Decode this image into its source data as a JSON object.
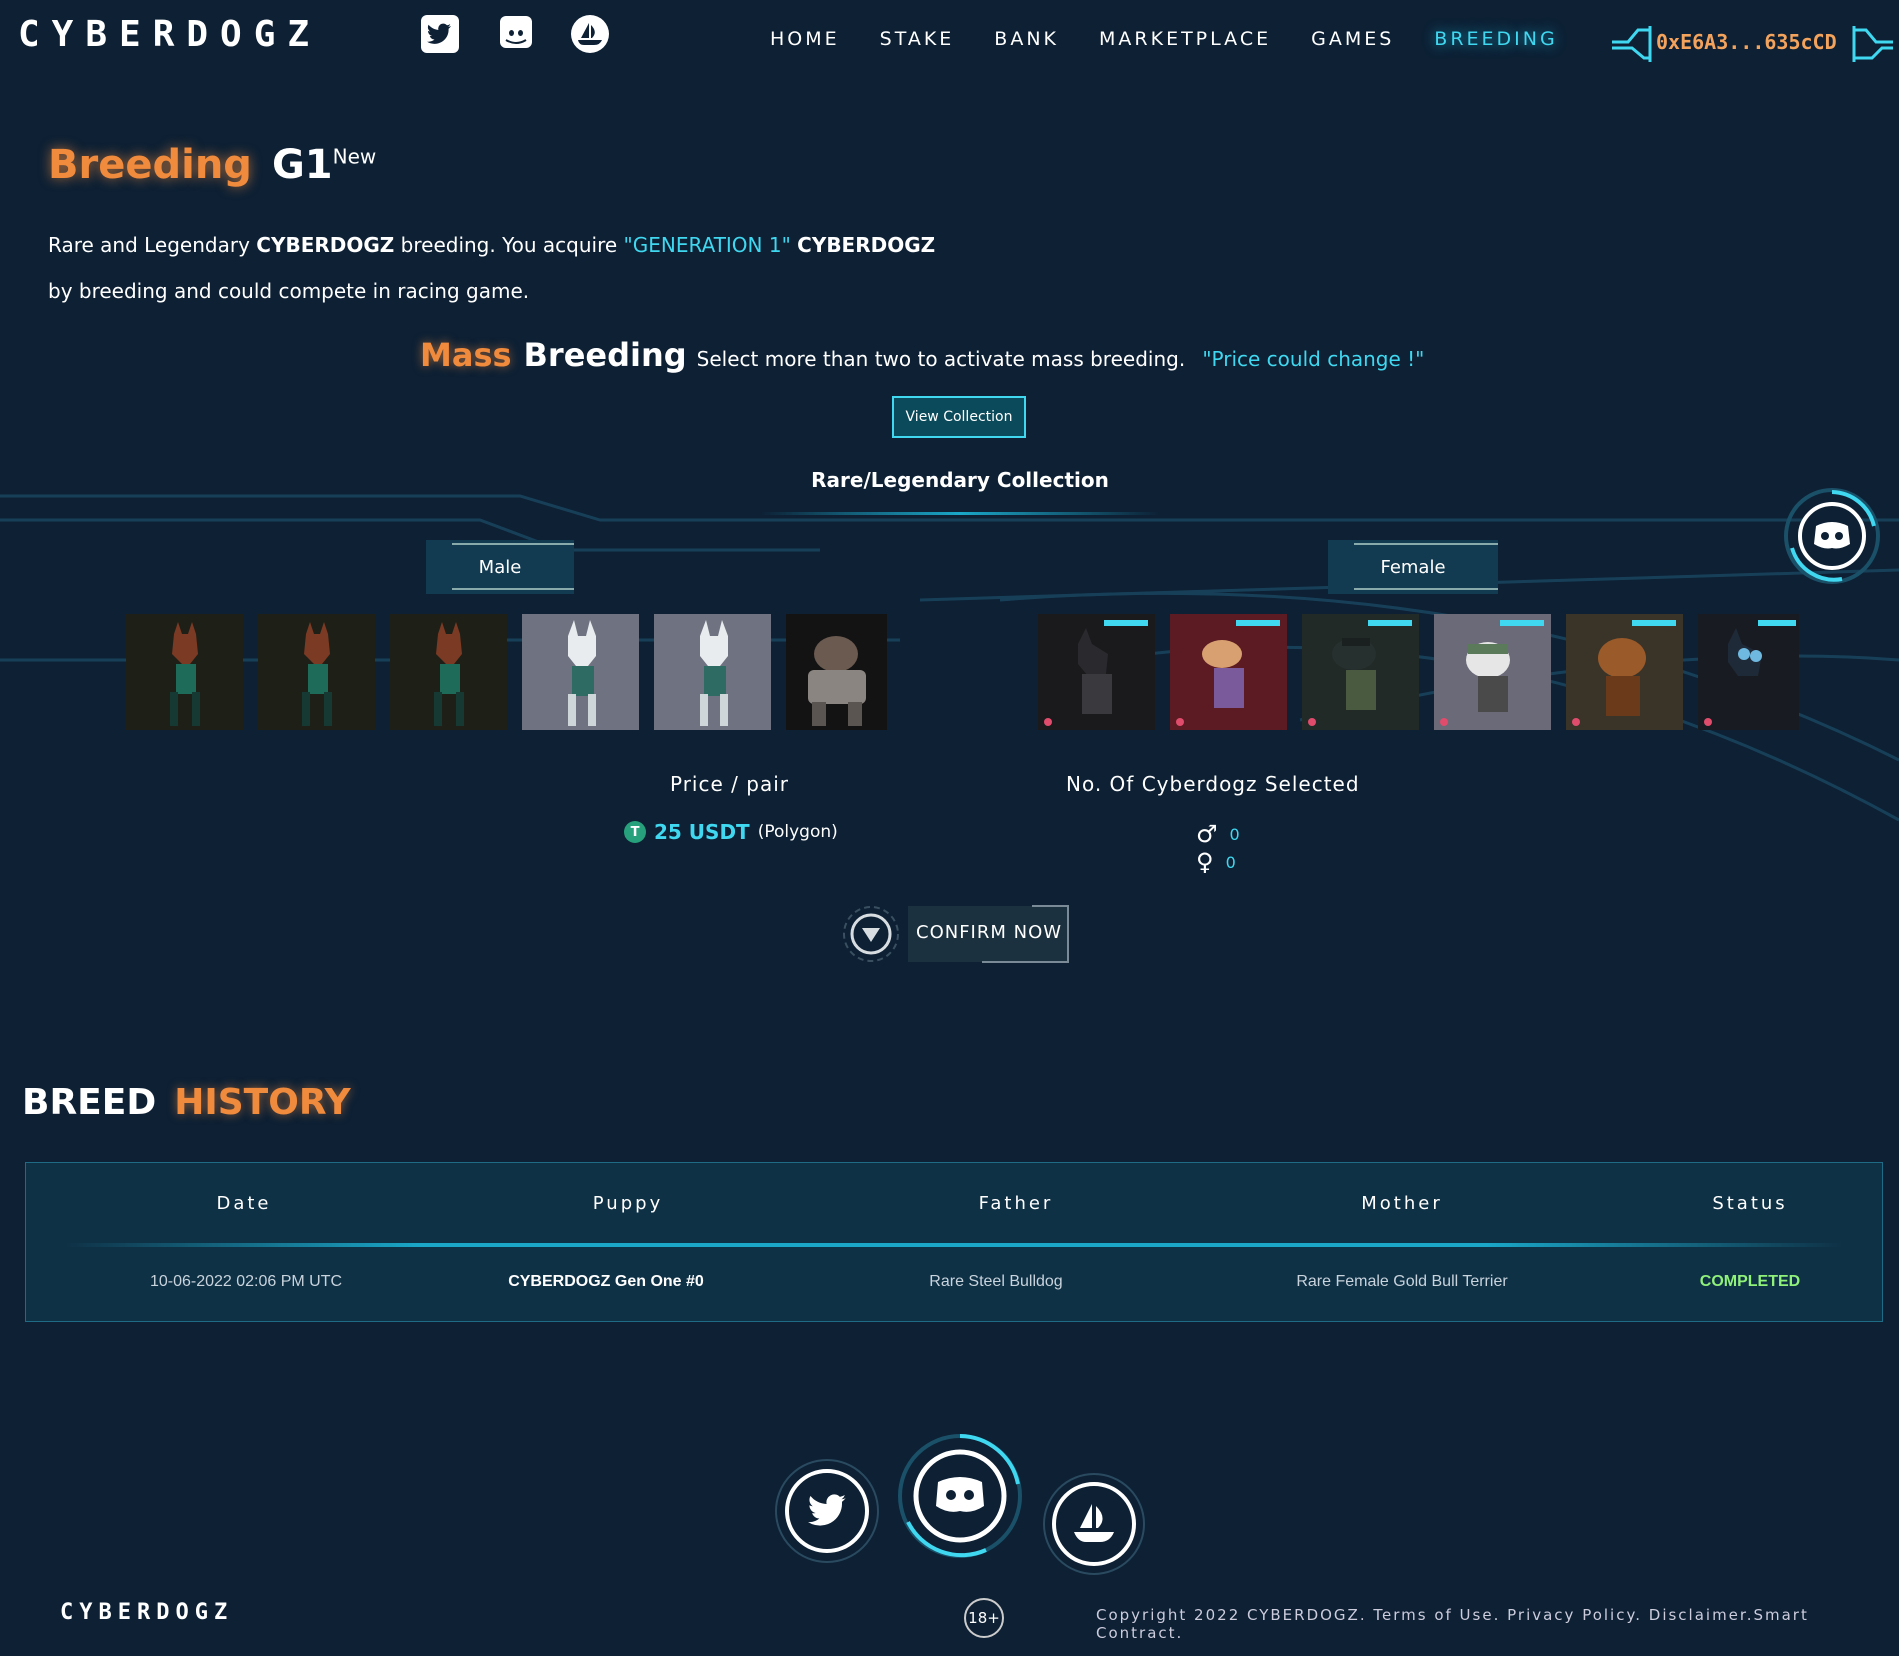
{
  "header": {
    "logo": "CYBERDOGZ",
    "social": [
      "twitter-icon",
      "discord-icon",
      "opensea-icon"
    ],
    "nav": [
      "HOME",
      "STAKE",
      "BANK",
      "MARKETPLACE",
      "GAMES",
      "BREEDING"
    ],
    "active_nav": "BREEDING",
    "wallet": "0xE6A3...635cCD"
  },
  "intro": {
    "title_1": "Breeding",
    "title_2": "G1",
    "title_sup": "New",
    "desc_1": "Rare and Legendary",
    "desc_brand": "CYBERDOGZ",
    "desc_2": "breeding. You acquire",
    "desc_gen": "\"GENERATION 1\"",
    "desc_brand2": "CYBERDOGZ",
    "desc_3": "by breeding and could compete in racing game."
  },
  "mass": {
    "word1": "Mass",
    "word2": "Breeding",
    "sub": "Select more than two to activate mass breeding.",
    "note": "\"Price could change !\"",
    "view_button": "View Collection"
  },
  "collection": {
    "title": "Rare/Legendary Collection",
    "male_tab": "Male",
    "female_tab": "Female",
    "male_count_thumbs": 6,
    "female_count_thumbs": 6
  },
  "pricing": {
    "label": "Price / pair",
    "amount": "25 USDT",
    "network": "(Polygon)",
    "selected_label": "No. Of Cyberdogz Selected",
    "male_selected": "0",
    "female_selected": "0",
    "confirm_label": "CONFIRM NOW"
  },
  "history": {
    "title_1": "BREED",
    "title_2": "HISTORY",
    "columns": [
      "Date",
      "Puppy",
      "Father",
      "Mother",
      "Status"
    ],
    "rows": [
      [
        "10-06-2022 02:06 PM UTC",
        "CYBERDOGZ Gen One #0",
        "Rare Steel Bulldog",
        "Rare Female Gold Bull Terrier",
        "COMPLETED"
      ]
    ]
  },
  "footer": {
    "logo": "CYBERDOGZ",
    "age": "18+",
    "copyright": "Copyright 2022 CYBERDOGZ.",
    "links": [
      "Terms of Use.",
      "Privacy Policy.",
      "Disclaimer.",
      "Smart Contract."
    ]
  },
  "colors": {
    "background": "#0d2034",
    "accent_cyan": "#3fd8f0",
    "accent_orange": "#f08a3c",
    "status_green": "#8ff07a"
  }
}
